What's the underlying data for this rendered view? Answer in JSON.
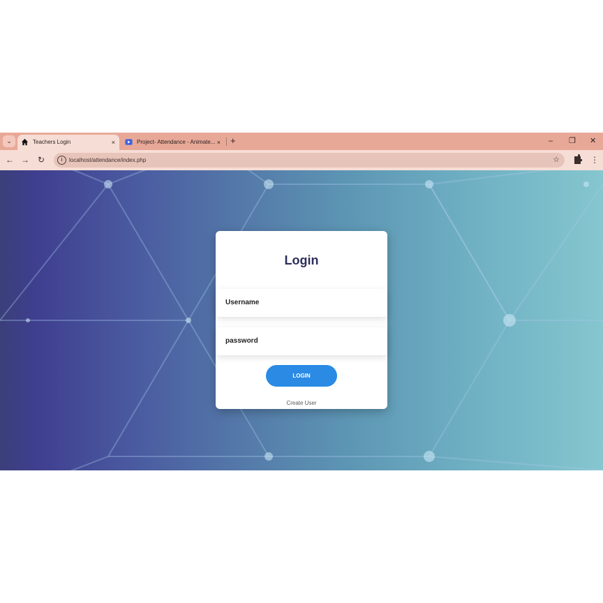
{
  "tabs": [
    {
      "title": "Teachers Login",
      "icon": "home-icon",
      "close": "×"
    },
    {
      "title": "Project- Attendance - Animate...",
      "icon": "video-icon",
      "close": "×"
    }
  ],
  "tabbar": {
    "menu": "⌄",
    "new_tab": "+",
    "minimize": "–",
    "restore": "❐",
    "close": "✕"
  },
  "toolbar": {
    "back": "←",
    "forward": "→",
    "reload": "↻",
    "url": "localhost/attendance/index.php",
    "info": "i",
    "bookmark": "☆",
    "menu": "⋮"
  },
  "login": {
    "title": "Login",
    "username_placeholder": "Username",
    "password_placeholder": "password",
    "button": "LOGIN",
    "create_user": "Create User"
  },
  "colors": {
    "accent": "#2a8ae4",
    "title": "#2d2e5a",
    "tabbar": "#e8a898"
  }
}
